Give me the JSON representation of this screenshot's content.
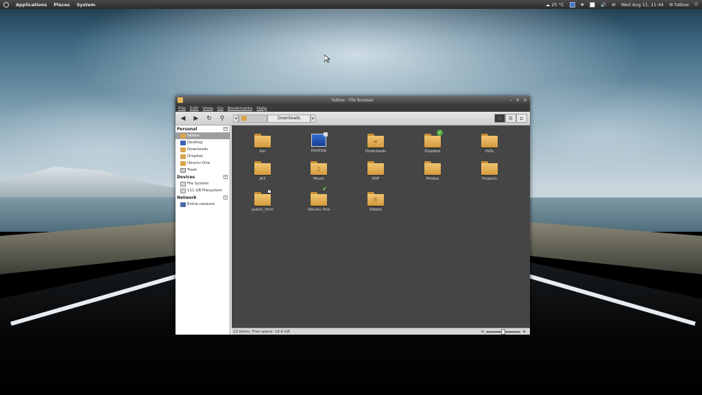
{
  "top_panel": {
    "menus": [
      "Applications",
      "Places",
      "System"
    ],
    "temperature": "25 °C",
    "datetime": "Wed Aug 11, 11:44",
    "username": "fatboe"
  },
  "window": {
    "title": "fatboe - File Browser",
    "menu": [
      "File",
      "Edit",
      "View",
      "Go",
      "Bookmarks",
      "Help"
    ],
    "path": {
      "current": "Downloads"
    }
  },
  "sidebar": {
    "personal_label": "Personal",
    "personal_items": [
      "fatboe",
      "Desktop",
      "Downloads",
      "Dropbox",
      "Ubuntu One",
      "Trash"
    ],
    "devices_label": "Devices",
    "devices_items": [
      "File System",
      "111 GB Filesystem"
    ],
    "network_label": "Network",
    "network_items": [
      "Entire network"
    ]
  },
  "files": [
    {
      "name": "bin",
      "icon": "folder-icon"
    },
    {
      "name": "Desktop",
      "icon": "desktop-icon"
    },
    {
      "name": "Downloads",
      "icon": "folder-downloads-icon"
    },
    {
      "name": "Dropbox",
      "icon": "folder-icon",
      "emblem": "sync-check-icon"
    },
    {
      "name": "ISOs",
      "icon": "folder-icon"
    },
    {
      "name": "JA2",
      "icon": "folder-icon"
    },
    {
      "name": "Music",
      "icon": "folder-music-icon"
    },
    {
      "name": "PDF",
      "icon": "folder-icon"
    },
    {
      "name": "Photos",
      "icon": "folder-icon"
    },
    {
      "name": "Projects",
      "icon": "folder-icon"
    },
    {
      "name": "public_html",
      "icon": "folder-icon",
      "emblem": "symlink-icon"
    },
    {
      "name": "Ubuntu One",
      "icon": "folder-icon",
      "emblem": "check-icon"
    },
    {
      "name": "Videos",
      "icon": "folder-videos-icon"
    }
  ],
  "statusbar": {
    "text": "13 items, Free space: 19.6 GB"
  }
}
